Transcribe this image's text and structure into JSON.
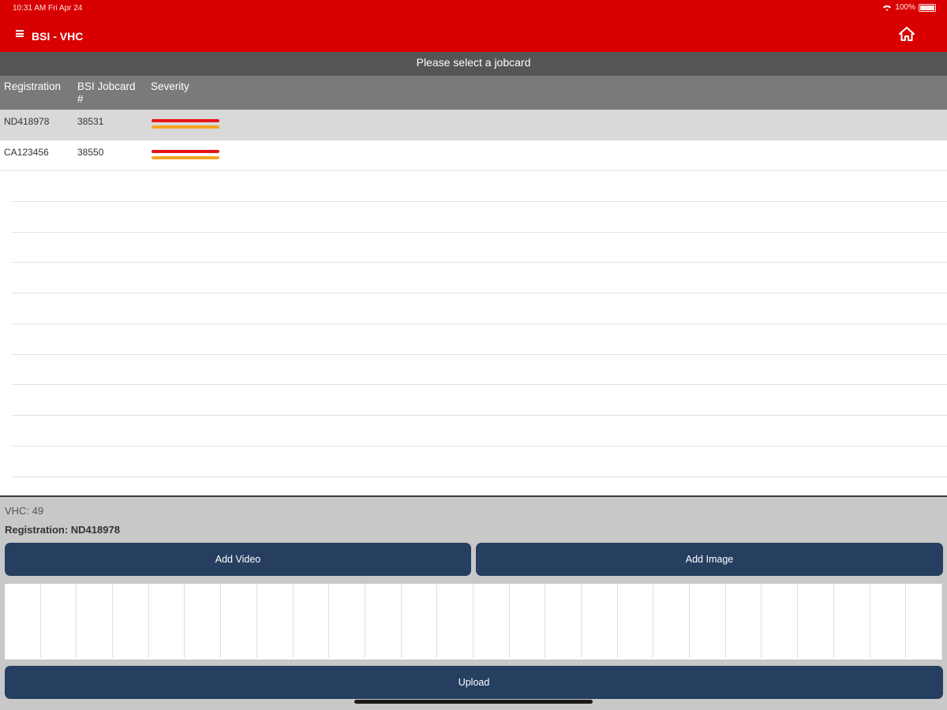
{
  "status_bar": {
    "time": "10:31 AM   Fri Apr 24",
    "battery": "100%"
  },
  "header": {
    "title": "BSI - VHC"
  },
  "subheader": {
    "text": "Please select a jobcard"
  },
  "table": {
    "columns": [
      "Registration",
      "BSI Jobcard #",
      "Severity"
    ],
    "column_lines": {
      "jobcard_1": "BSI Jobcard",
      "jobcard_2": "#"
    },
    "rows": [
      {
        "registration": "ND418978",
        "jobcard": "38531",
        "severity": [
          "red",
          "amber"
        ],
        "selected": true
      },
      {
        "registration": "CA123456",
        "jobcard": "38550",
        "severity": [
          "red",
          "amber"
        ],
        "selected": false
      }
    ]
  },
  "colors": {
    "brand": "#d80000",
    "button": "#263f60",
    "severity_red": "#e8141b",
    "severity_amber": "#f5a623"
  },
  "detail": {
    "vhc": "VHC: 49",
    "registration": "Registration: ND418978",
    "add_video_label": "Add Video",
    "add_image_label": "Add Image",
    "upload_label": "Upload"
  }
}
